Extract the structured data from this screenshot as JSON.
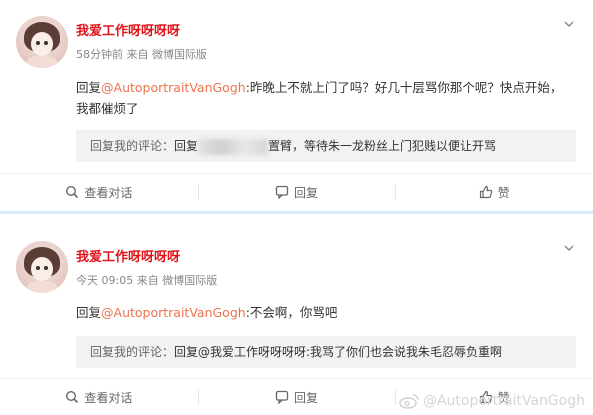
{
  "comments": [
    {
      "username": "我爱工作呀呀呀呀",
      "time": "58分钟前",
      "source": "来自 微博国际版",
      "reply_prefix": "回复",
      "mention": "@AutoportraitVanGogh",
      "text": ":昨晚上不就上门了吗？好几十层骂你那个呢？快点开始，我都催烦了",
      "quote_prefix": "回复我的评论：",
      "quote_text_a": "回复",
      "quote_text_b": "置臂，等待朱一龙粉丝上门犯贱以便让开骂",
      "actions": [
        "查看对话",
        "回复",
        "赞"
      ]
    },
    {
      "username": "我爱工作呀呀呀呀",
      "time": "今天 09:05",
      "source": "来自 微博国际版",
      "reply_prefix": "回复",
      "mention": "@AutoportraitVanGogh",
      "text": ":不会啊，你骂吧",
      "quote_prefix": "回复我的评论：",
      "quote_text": "回复@我爱工作呀呀呀呀:我骂了你们也会说我朱毛忍辱负重啊",
      "actions": [
        "查看对话",
        "回复",
        "赞"
      ]
    }
  ],
  "watermark": "@AutoportraitVanGogh",
  "colors": {
    "username": "#e0141b",
    "mention": "#eb7350",
    "separator": "#d9ecf9"
  }
}
